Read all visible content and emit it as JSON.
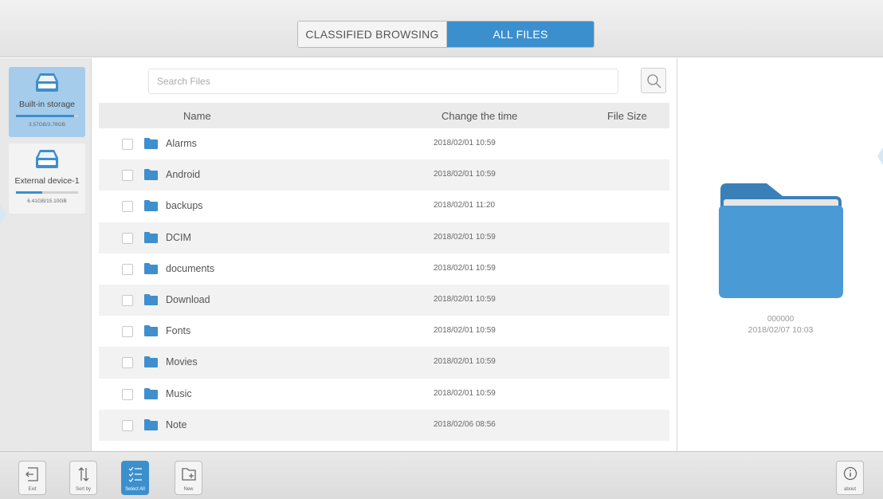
{
  "header": {
    "tabs": [
      {
        "label": "CLASSIFIED BROWSING",
        "active": false
      },
      {
        "label": "ALL FILES",
        "active": true
      }
    ]
  },
  "storage": [
    {
      "label": "Built-in storage",
      "size": "3.57GB/3.78GB",
      "used_fraction": 0.94,
      "active": true
    },
    {
      "label": "External device-1",
      "size": "6.41GB/15.10GB",
      "used_fraction": 0.42,
      "active": false
    }
  ],
  "search": {
    "placeholder": "Search Files"
  },
  "table": {
    "columns": [
      "Name",
      "Change the time",
      "File Size"
    ],
    "rows": [
      {
        "name": "Alarms",
        "time": "2018/02/01 10:59",
        "size": ""
      },
      {
        "name": "Android",
        "time": "2018/02/01 10:59",
        "size": ""
      },
      {
        "name": "backups",
        "time": "2018/02/01 11:20",
        "size": ""
      },
      {
        "name": "DCIM",
        "time": "2018/02/01 10:59",
        "size": ""
      },
      {
        "name": "documents",
        "time": "2018/02/01 10:59",
        "size": ""
      },
      {
        "name": "Download",
        "time": "2018/02/01 10:59",
        "size": ""
      },
      {
        "name": "Fonts",
        "time": "2018/02/01 10:59",
        "size": ""
      },
      {
        "name": "Movies",
        "time": "2018/02/01 10:59",
        "size": ""
      },
      {
        "name": "Music",
        "time": "2018/02/01 10:59",
        "size": ""
      },
      {
        "name": "Note",
        "time": "2018/02/06 08:56",
        "size": ""
      }
    ]
  },
  "preview": {
    "name": "000000",
    "date": "2018/02/07 10:03",
    "icon": "folder-icon"
  },
  "toolbar": {
    "exit": "Exit",
    "sort": "Sort by",
    "select_all": "Select All",
    "new": "New",
    "about": "about"
  },
  "colors": {
    "accent": "#3c8fcd",
    "folder": "#4a9ad6",
    "folder_dark": "#3a80b8"
  }
}
